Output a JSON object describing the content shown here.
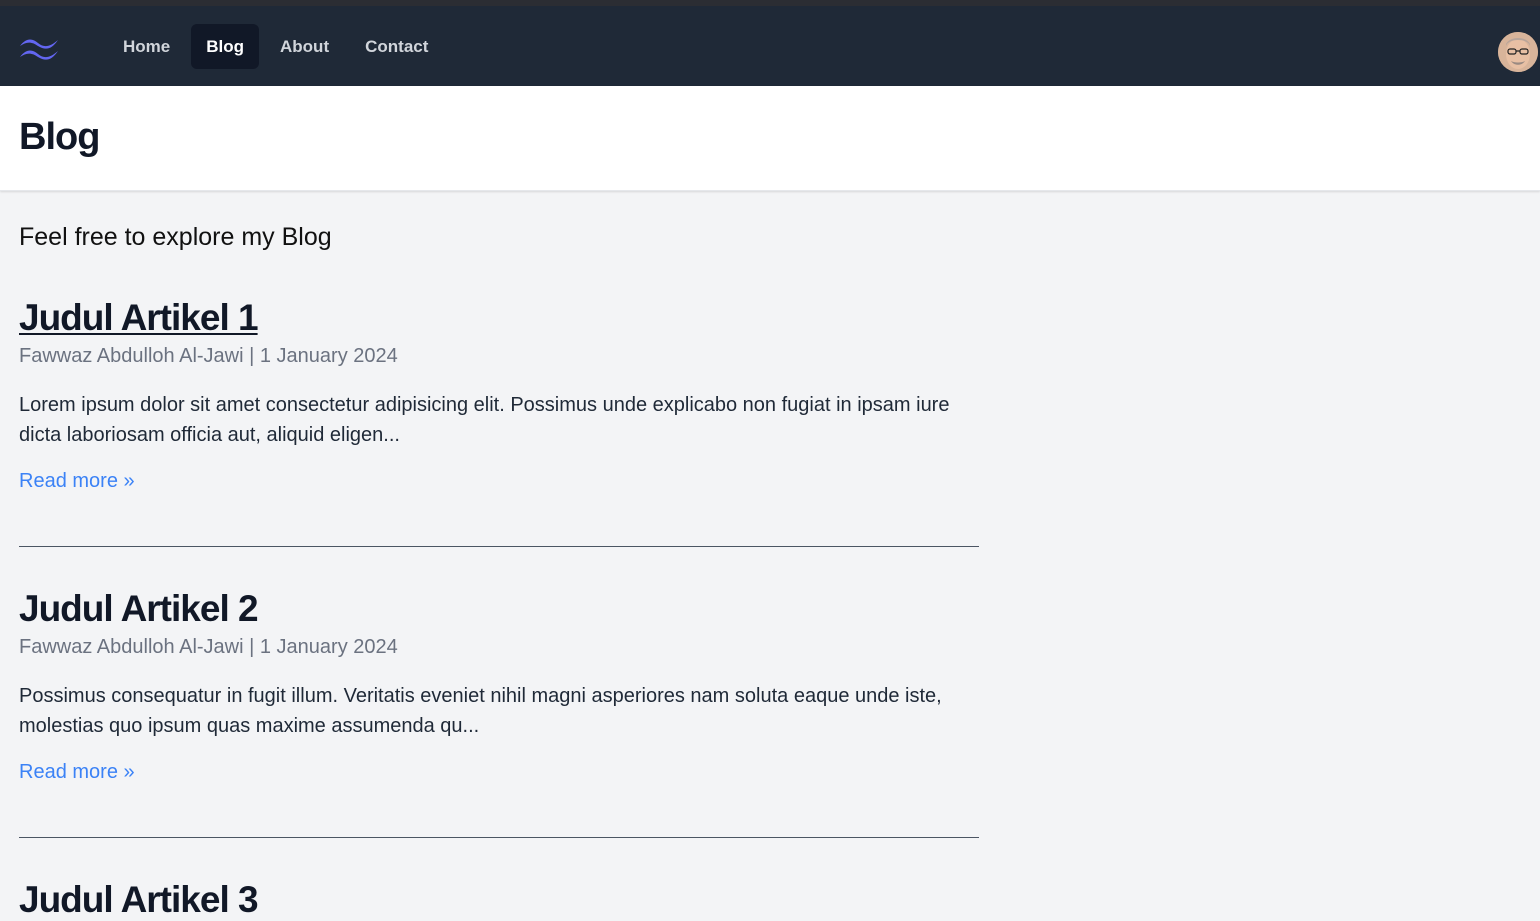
{
  "nav": {
    "links": [
      {
        "label": "Home",
        "active": false
      },
      {
        "label": "Blog",
        "active": true
      },
      {
        "label": "About",
        "active": false
      },
      {
        "label": "Contact",
        "active": false
      }
    ],
    "logo_icon": "tailwind-wave-icon",
    "avatar_icon": "user-avatar"
  },
  "header": {
    "title": "Blog"
  },
  "main": {
    "intro": "Feel free to explore my Blog",
    "articles": [
      {
        "title": "Judul Artikel 1",
        "meta": "Fawwaz Abdulloh Al-Jawi | 1 January 2024",
        "excerpt": "Lorem ipsum dolor sit amet consectetur adipisicing elit. Possimus unde explicabo non fugiat in ipsam iure dicta laboriosam officia aut, aliquid eligen...",
        "read_more": "Read more »"
      },
      {
        "title": "Judul Artikel 2",
        "meta": "Fawwaz Abdulloh Al-Jawi | 1 January 2024",
        "excerpt": "Possimus consequatur in fugit illum. Veritatis eveniet nihil magni asperiores nam soluta eaque unde iste, molestias quo ipsum quas maxime assumenda qu...",
        "read_more": "Read more »"
      },
      {
        "title": "Judul Artikel 3"
      }
    ]
  },
  "colors": {
    "nav_bg": "#1f2937",
    "page_bg": "#f3f4f6",
    "link": "#3b82f6",
    "logo": "#6366f1"
  }
}
